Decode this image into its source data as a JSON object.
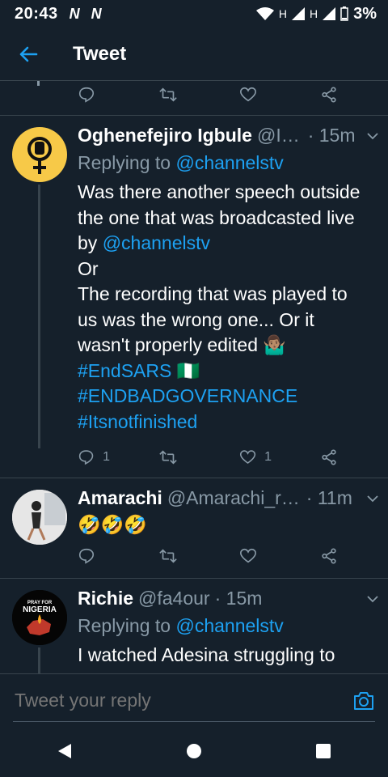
{
  "status_bar": {
    "time": "20:43",
    "network_a": "H",
    "network_b": "H",
    "battery": "3%"
  },
  "header": {
    "title": "Tweet"
  },
  "composer": {
    "placeholder": "Tweet your reply"
  },
  "tweets": [
    {
      "name": "Oghenefejiro Igbule",
      "handle": "@I…",
      "time": "· 15m",
      "replying_prefix": "Replying to ",
      "replying_to": "@channelstv",
      "lines": [
        "Was there another speech outside",
        "the one  that was broadcasted live"
      ],
      "by_prefix": "by ",
      "mention": "@channelstv",
      "or": "Or",
      "lines2": [
        "The recording that was played to",
        "us was the wrong one... Or it",
        "wasn't properly edited 🤷🏽‍♂️"
      ],
      "hashtags": [
        "#EndSARS 🇳🇬",
        "#ENDBADGOVERNANCE",
        "#Itsnotfinished"
      ],
      "replies": "1",
      "likes": "1"
    },
    {
      "name": "Amarachi",
      "handle": "@Amarachi_r…",
      "time": "· 11m",
      "text": "🤣🤣🤣"
    },
    {
      "name": "Richie",
      "handle": "@fa4our",
      "time": "· 15m",
      "replying_prefix": "Replying to ",
      "replying_to": "@channelstv",
      "text": "I watched Adesina struggling to",
      "avatar_text_top": "PRAY FOR",
      "avatar_text_main": "NIGERIA"
    }
  ],
  "colors": {
    "background": "#15202b",
    "accent": "#1da1f2",
    "muted": "#8899a6",
    "divider": "#38444d"
  }
}
